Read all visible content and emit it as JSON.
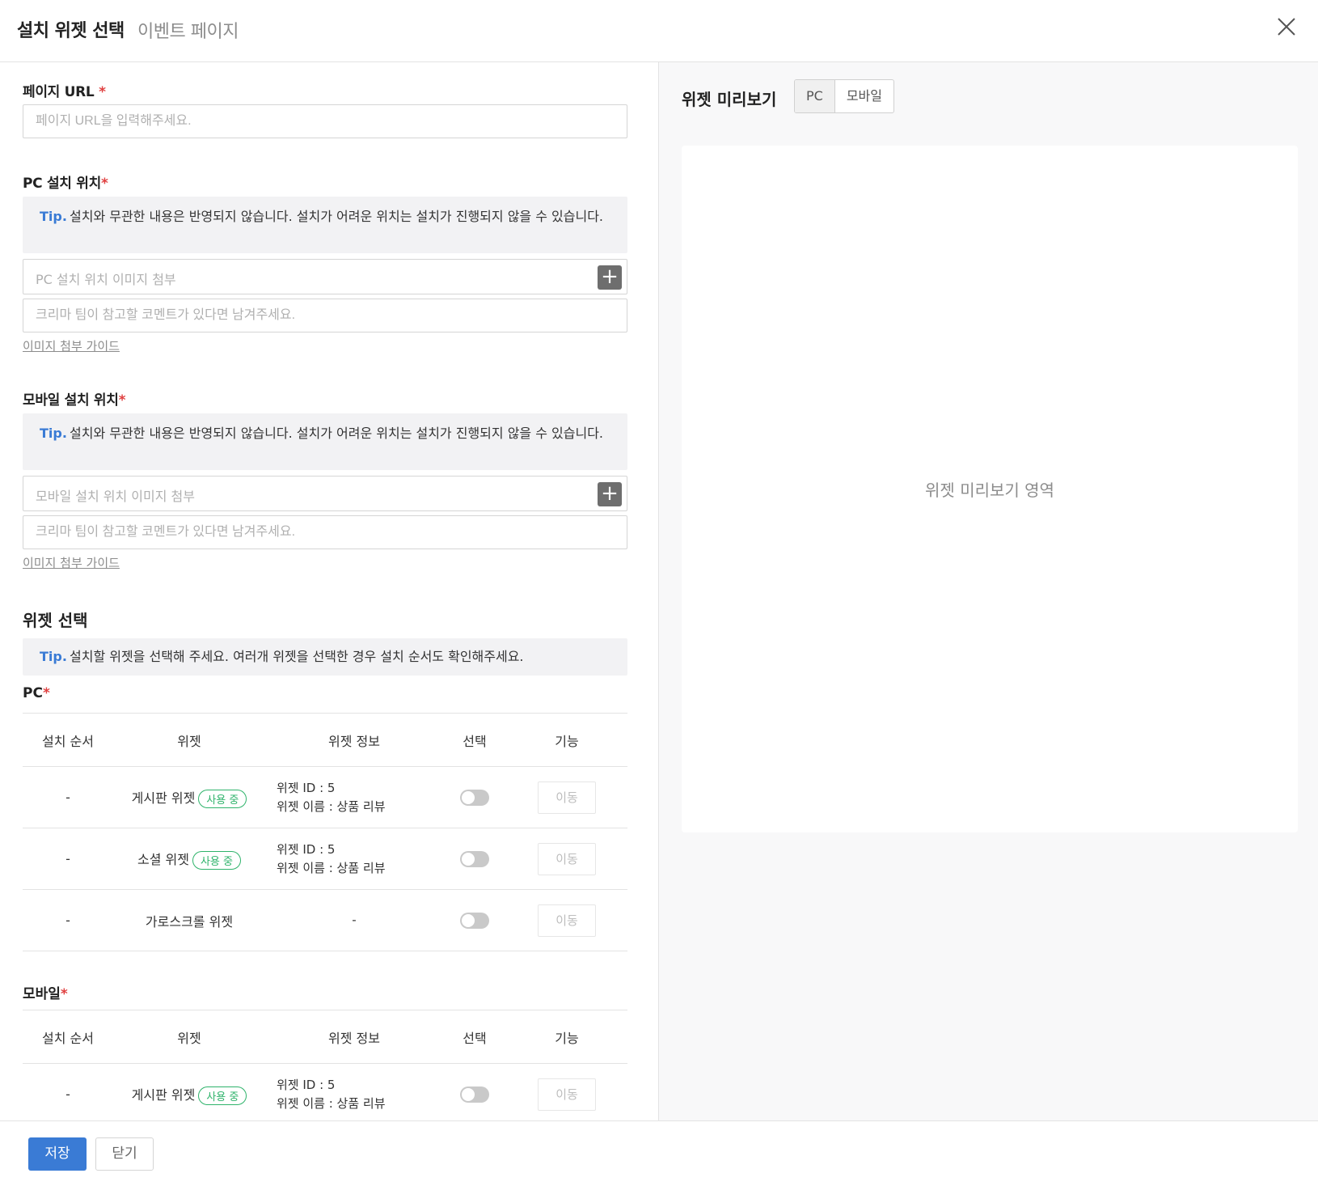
{
  "header": {
    "title": "설치 위젯 선택",
    "subtitle": "이벤트 페이지",
    "close_icon": "close-icon"
  },
  "form": {
    "page_url": {
      "label": "페이지 URL ",
      "required_mark": "*",
      "placeholder": "페이지 URL을 입력해주세요."
    },
    "pc_location": {
      "label": "PC 설치 위치",
      "required_mark": "*",
      "tip_label": "Tip.",
      "tip_text": "설치와 무관한 내용은 반영되지 않습니다. 설치가 어려운 위치는 설치가 진행되지 않을 수 있습니다.",
      "attach_placeholder": "PC 설치 위치 이미지 첨부",
      "comment_placeholder": "크리마 팀이 참고할 코멘트가 있다면 남겨주세요.",
      "guide_link": "이미지 첨부 가이드"
    },
    "mobile_location": {
      "label": "모바일 설치 위치",
      "required_mark": "*",
      "tip_label": "Tip.",
      "tip_text": "설치와 무관한 내용은 반영되지 않습니다. 설치가 어려운 위치는 설치가 진행되지 않을 수 있습니다.",
      "attach_placeholder": "모바일 설치 위치 이미지 첨부",
      "comment_placeholder": "크리마 팀이 참고할 코멘트가 있다면 남겨주세요.",
      "guide_link": "이미지 첨부 가이드"
    },
    "widget_select": {
      "title": "위젯 선택",
      "tip_label": "Tip.",
      "tip_text": "설치할 위젯을 선택해 주세요. 여러개 위젯을 선택한 경우 설치 순서도 확인해주세요.",
      "columns": [
        "설치 순서",
        "위젯",
        "위젯 정보",
        "선택",
        "기능"
      ],
      "pc": {
        "label": "PC",
        "required_mark": "*",
        "rows": [
          {
            "order": "-",
            "widget": "게시판 위젯",
            "badge": "사용 중",
            "info_id": "위젯 ID : 5",
            "info_name": "위젯 이름 : 상품 리뷰",
            "selected": false,
            "action": "이동"
          },
          {
            "order": "-",
            "widget": "소셜 위젯",
            "badge": "사용 중",
            "info_id": "위젯 ID : 5",
            "info_name": "위젯 이름 : 상품 리뷰",
            "selected": false,
            "action": "이동"
          },
          {
            "order": "-",
            "widget": "가로스크롤 위젯",
            "badge": "",
            "info_dash": "-",
            "selected": false,
            "action": "이동"
          }
        ]
      },
      "mobile": {
        "label": "모바일",
        "required_mark": "*",
        "rows": [
          {
            "order": "-",
            "widget": "게시판 위젯",
            "badge": "사용 중",
            "info_id": "위젯 ID : 5",
            "info_name": "위젯 이름 : 상품 리뷰",
            "selected": false,
            "action": "이동"
          }
        ]
      }
    }
  },
  "preview": {
    "title": "위젯 미리보기",
    "tabs": [
      "PC",
      "모바일"
    ],
    "active_tab": "PC",
    "placeholder": "위젯 미리보기 영역"
  },
  "footer": {
    "save_label": "저장",
    "close_label": "닫기"
  },
  "colors": {
    "accent": "#3a7bd5",
    "required": "#e04040",
    "badge": "#2fb36b"
  }
}
